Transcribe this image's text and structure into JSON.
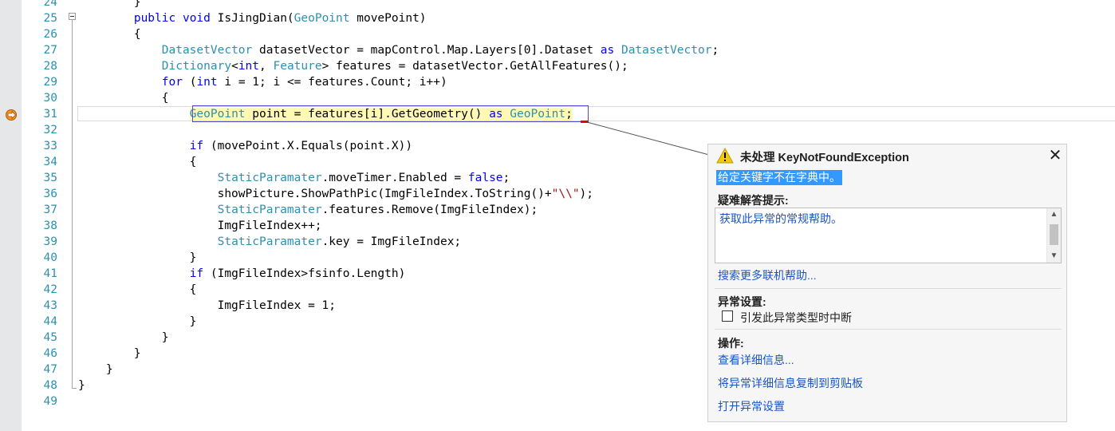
{
  "editor": {
    "lines": [
      {
        "num": "24",
        "tokens": [
          {
            "t": "        }",
            "c": ""
          }
        ]
      },
      {
        "num": "25",
        "tokens": [
          {
            "t": "        ",
            "c": ""
          },
          {
            "t": "public",
            "c": "kw"
          },
          {
            "t": " ",
            "c": ""
          },
          {
            "t": "void",
            "c": "kw"
          },
          {
            "t": " IsJingDian(",
            "c": ""
          },
          {
            "t": "GeoPoint",
            "c": "ty"
          },
          {
            "t": " movePoint)",
            "c": ""
          }
        ]
      },
      {
        "num": "26",
        "tokens": [
          {
            "t": "        {",
            "c": ""
          }
        ]
      },
      {
        "num": "27",
        "tokens": [
          {
            "t": "            ",
            "c": ""
          },
          {
            "t": "DatasetVector",
            "c": "ty"
          },
          {
            "t": " datasetVector = mapControl.Map.Layers[0].Dataset ",
            "c": ""
          },
          {
            "t": "as",
            "c": "kw"
          },
          {
            "t": " ",
            "c": ""
          },
          {
            "t": "DatasetVector",
            "c": "ty"
          },
          {
            "t": ";",
            "c": ""
          }
        ]
      },
      {
        "num": "28",
        "tokens": [
          {
            "t": "            ",
            "c": ""
          },
          {
            "t": "Dictionary",
            "c": "ty"
          },
          {
            "t": "<",
            "c": ""
          },
          {
            "t": "int",
            "c": "kw"
          },
          {
            "t": ", ",
            "c": ""
          },
          {
            "t": "Feature",
            "c": "ty"
          },
          {
            "t": "> features = datasetVector.GetAllFeatures();",
            "c": ""
          }
        ]
      },
      {
        "num": "29",
        "tokens": [
          {
            "t": "            ",
            "c": ""
          },
          {
            "t": "for",
            "c": "kw"
          },
          {
            "t": " (",
            "c": ""
          },
          {
            "t": "int",
            "c": "kw"
          },
          {
            "t": " i = 1; i <= features.Count; i++)",
            "c": ""
          }
        ]
      },
      {
        "num": "30",
        "tokens": [
          {
            "t": "            {",
            "c": ""
          }
        ]
      },
      {
        "num": "31",
        "current": true,
        "tokens": [
          {
            "t": "                ",
            "c": ""
          },
          {
            "t": "GeoPoint",
            "c": "ty hl"
          },
          {
            "t": " point = features[i].GetGeometry() ",
            "c": "hl"
          },
          {
            "t": "as",
            "c": "kw hl"
          },
          {
            "t": " ",
            "c": "hl"
          },
          {
            "t": "GeoPoint",
            "c": "ty hl"
          },
          {
            "t": ";",
            "c": "hl"
          }
        ]
      },
      {
        "num": "32",
        "tokens": [
          {
            "t": "",
            "c": ""
          }
        ]
      },
      {
        "num": "33",
        "tokens": [
          {
            "t": "                ",
            "c": ""
          },
          {
            "t": "if",
            "c": "kw"
          },
          {
            "t": " (movePoint.X.Equals(point.X))",
            "c": ""
          }
        ]
      },
      {
        "num": "34",
        "tokens": [
          {
            "t": "                {",
            "c": ""
          }
        ]
      },
      {
        "num": "35",
        "tokens": [
          {
            "t": "                    ",
            "c": ""
          },
          {
            "t": "StaticParamater",
            "c": "ty"
          },
          {
            "t": ".moveTimer.Enabled = ",
            "c": ""
          },
          {
            "t": "false",
            "c": "kw"
          },
          {
            "t": ";",
            "c": ""
          }
        ]
      },
      {
        "num": "36",
        "tokens": [
          {
            "t": "                    showPicture.ShowPathPic(ImgFileIndex.ToString()+",
            "c": ""
          },
          {
            "t": "\"\\\\\"",
            "c": "st"
          },
          {
            "t": ");",
            "c": ""
          }
        ]
      },
      {
        "num": "37",
        "tokens": [
          {
            "t": "                    ",
            "c": ""
          },
          {
            "t": "StaticParamater",
            "c": "ty"
          },
          {
            "t": ".features.Remove(ImgFileIndex);",
            "c": ""
          }
        ]
      },
      {
        "num": "38",
        "tokens": [
          {
            "t": "                    ImgFileIndex++;",
            "c": ""
          }
        ]
      },
      {
        "num": "39",
        "tokens": [
          {
            "t": "                    ",
            "c": ""
          },
          {
            "t": "StaticParamater",
            "c": "ty"
          },
          {
            "t": ".key = ImgFileIndex;",
            "c": ""
          }
        ]
      },
      {
        "num": "40",
        "tokens": [
          {
            "t": "                }",
            "c": ""
          }
        ]
      },
      {
        "num": "41",
        "tokens": [
          {
            "t": "                ",
            "c": ""
          },
          {
            "t": "if",
            "c": "kw"
          },
          {
            "t": " (ImgFileIndex>fsinfo.Length)",
            "c": ""
          }
        ]
      },
      {
        "num": "42",
        "tokens": [
          {
            "t": "                {",
            "c": ""
          }
        ]
      },
      {
        "num": "43",
        "tokens": [
          {
            "t": "                    ImgFileIndex = 1;",
            "c": ""
          }
        ]
      },
      {
        "num": "44",
        "tokens": [
          {
            "t": "                }",
            "c": ""
          }
        ]
      },
      {
        "num": "45",
        "tokens": [
          {
            "t": "            }",
            "c": ""
          }
        ]
      },
      {
        "num": "46",
        "tokens": [
          {
            "t": "        }",
            "c": ""
          }
        ]
      },
      {
        "num": "47",
        "tokens": [
          {
            "t": "    }",
            "c": ""
          }
        ]
      },
      {
        "num": "48",
        "tokens": [
          {
            "t": "}",
            "c": ""
          }
        ]
      },
      {
        "num": "49",
        "tokens": [
          {
            "t": "",
            "c": ""
          }
        ]
      }
    ]
  },
  "exception": {
    "title": "未处理 KeyNotFoundException",
    "message": "给定关键字不在字典中。",
    "tips_heading": "疑难解答提示:",
    "tip_link": "获取此异常的常规帮助。",
    "search_link": "搜索更多联机帮助...",
    "settings_heading": "异常设置:",
    "break_checkbox_label": "引发此异常类型时中断",
    "break_checked": false,
    "actions_heading": "操作:",
    "action_view_details": "查看详细信息...",
    "action_copy": "将异常详细信息复制到剪贴板",
    "action_open_settings": "打开异常设置",
    "close_glyph": "✕"
  },
  "colors": {
    "keyword": "#0000ff",
    "type": "#2b91af",
    "line_number": "#2b91af",
    "highlight": "#fff9b2",
    "error_box": "#4b4bd8",
    "link": "#1a55c8",
    "selection": "#3399ff"
  }
}
